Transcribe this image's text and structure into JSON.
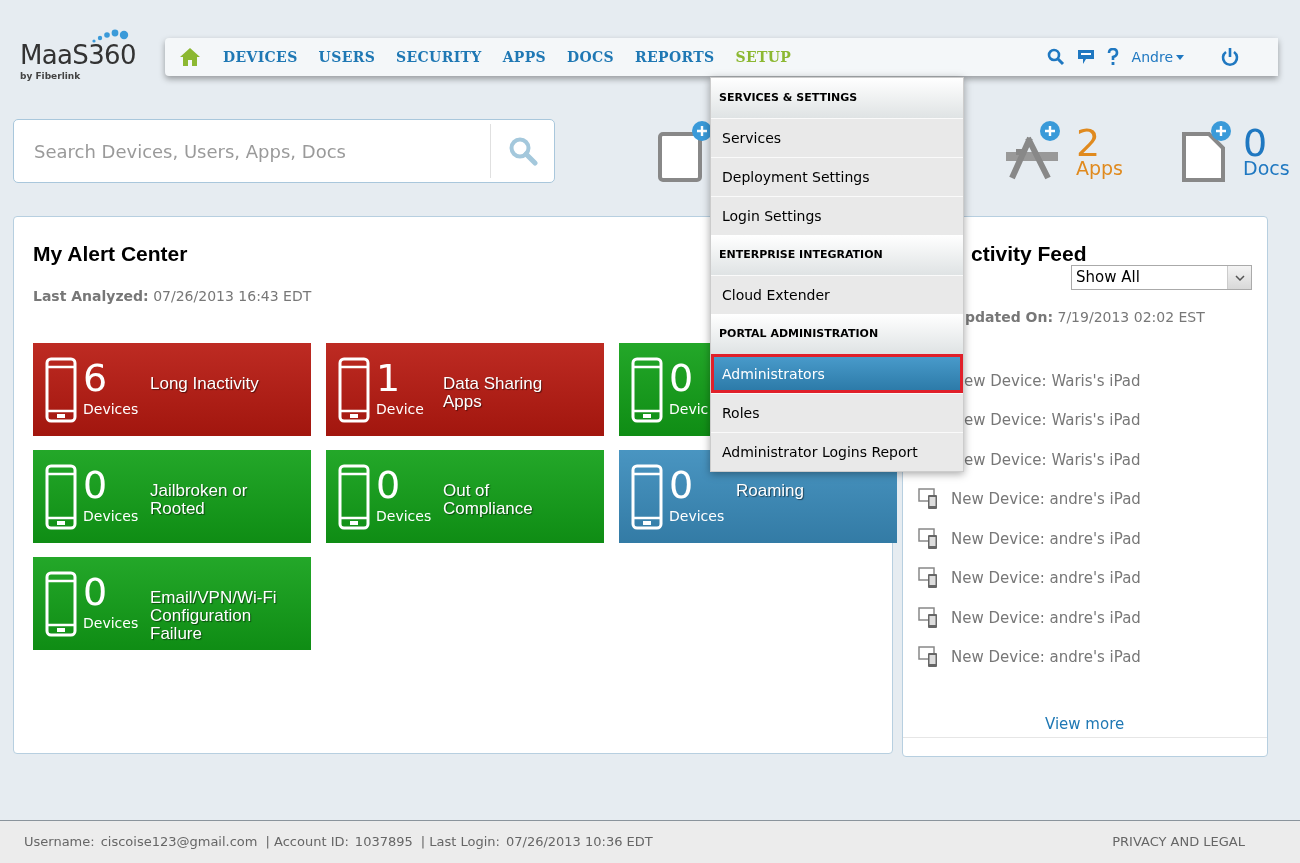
{
  "logo": {
    "name": "MaaS360",
    "byline": "by Fiberlink"
  },
  "nav": [
    {
      "label": "DEVICES",
      "selected": false
    },
    {
      "label": "USERS",
      "selected": false
    },
    {
      "label": "SECURITY",
      "selected": false
    },
    {
      "label": "APPS",
      "selected": false
    },
    {
      "label": "DOCS",
      "selected": false
    },
    {
      "label": "REPORTS",
      "selected": false
    },
    {
      "label": "SETUP",
      "selected": true
    }
  ],
  "user_menu": {
    "label": "Andre"
  },
  "search": {
    "placeholder": "Search Devices, Users, Apps, Docs"
  },
  "stats": [
    {
      "kind": "devices"
    },
    {
      "kind": "apps",
      "count": "2",
      "label": "Apps",
      "color": "#e08a1e"
    },
    {
      "kind": "docs",
      "count": "0",
      "label": "Docs",
      "color": "#1f78c1"
    }
  ],
  "alert_center": {
    "title": "My Alert Center",
    "analyzed_label": "Last Analyzed:",
    "analyzed_value": "07/26/2013 16:43 EDT",
    "tiles": [
      {
        "color": "#b81910",
        "count": "6",
        "unit": "Devices",
        "label": "Long Inactivity"
      },
      {
        "color": "#b81910",
        "count": "1",
        "unit": "Device",
        "label": "Data Sharing Apps"
      },
      {
        "color": "#11a017",
        "count": "0",
        "unit": "Devic"
      },
      {
        "color": "#11a017",
        "count": "0",
        "unit": "Devices",
        "label": "Jailbroken or Rooted"
      },
      {
        "color": "#11a017",
        "count": "0",
        "unit": "Devices",
        "label": "Out of Compliance"
      },
      {
        "color": "#3a8cbc",
        "count": "0",
        "unit": "Devices",
        "label": "Roaming"
      },
      {
        "color": "#11a017",
        "count": "0",
        "unit": "Devices",
        "label": "Email/VPN/Wi-Fi Configuration Failure"
      }
    ]
  },
  "activity_feed": {
    "title": "ctivity Feed",
    "filter": "Show All",
    "updated_label": "pdated On:",
    "updated_value": "7/19/2013 02:02 EST",
    "items": [
      {
        "kind": "covered",
        "text": "ew Device: Waris's iPad"
      },
      {
        "kind": "covered",
        "text": "ew Device: Waris's iPad"
      },
      {
        "kind": "covered",
        "text": "ew Device: Waris's iPad"
      },
      {
        "kind": "device",
        "text": "New Device: andre's iPad"
      },
      {
        "kind": "device",
        "text": "New Device: andre's iPad"
      },
      {
        "kind": "device",
        "text": "New Device: andre's iPad"
      },
      {
        "kind": "device",
        "text": "New Device: andre's iPad"
      },
      {
        "kind": "device",
        "text": "New Device: andre's iPad"
      }
    ],
    "more": "View more"
  },
  "setup_menu": [
    {
      "heading": "SERVICES & SETTINGS",
      "items": [
        {
          "label": "Services",
          "selected": false
        },
        {
          "label": "Deployment Settings",
          "selected": false
        },
        {
          "label": "Login Settings",
          "selected": false
        }
      ]
    },
    {
      "heading": "ENTERPRISE INTEGRATION",
      "items": [
        {
          "label": "Cloud Extender",
          "selected": false
        }
      ]
    },
    {
      "heading": "PORTAL ADMINISTRATION",
      "items": [
        {
          "label": "Administrators",
          "selected": true
        },
        {
          "label": "Roles",
          "selected": false
        },
        {
          "label": "Administrator Logins Report",
          "selected": false
        }
      ]
    }
  ],
  "footer": {
    "username_label": "Username:",
    "username": "ciscoise123@gmail.com",
    "account_label": "| Account ID:",
    "account": "1037895",
    "login_label": "| Last Login:",
    "login": "07/26/2013 10:36 EDT",
    "privacy": "PRIVACY AND LEGAL"
  }
}
